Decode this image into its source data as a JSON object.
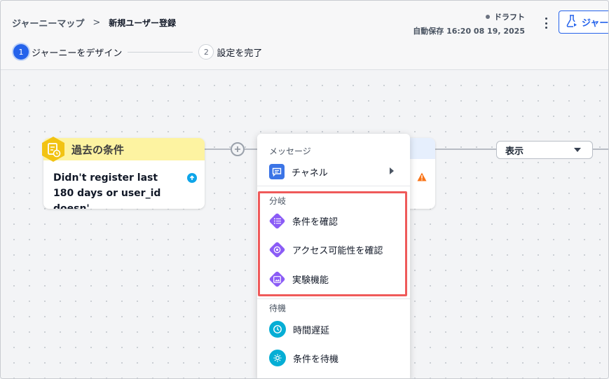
{
  "breadcrumb": {
    "root": "ジャーニーマップ",
    "separator": ">",
    "current": "新規ユーザー登録"
  },
  "status": {
    "draft": "ドラフト",
    "autosave": "自動保存  16:20 08 19, 2025"
  },
  "header": {
    "journey_button_label": "ジャー"
  },
  "steps": [
    {
      "number": "1",
      "label": "ジャーニーをデザイン",
      "active": true
    },
    {
      "number": "2",
      "label": "設定を完了",
      "active": false
    }
  ],
  "past_condition_node": {
    "title": "過去の条件",
    "body": "Didn't register last 180 days or user_id doesn'..."
  },
  "display_select": {
    "value": "表示"
  },
  "menu": {
    "message_section": "メッセージ",
    "channel": "チャネル",
    "branch_section": "分岐",
    "branch_items": [
      "条件を確認",
      "アクセス可能性を確認",
      "実験機能"
    ],
    "wait_section": "待機",
    "wait_items": [
      "時間遅延",
      "条件を待機"
    ]
  },
  "colors": {
    "accent": "#2563eb",
    "branch_icon": "#8b5cf6",
    "wait_icon": "#06aed5",
    "channel_icon": "#3b74e6",
    "condition_header": "#fdf3a1",
    "highlight": "#ef5a5a",
    "warning": "#f97316"
  },
  "icons": {
    "channel": "chat-icon",
    "check_condition": "list-icon",
    "check_access": "target-icon",
    "experiment": "image-icon",
    "time_delay": "clock-icon",
    "wait_condition": "gear-icon",
    "past_condition": "calendar-clock-icon"
  }
}
